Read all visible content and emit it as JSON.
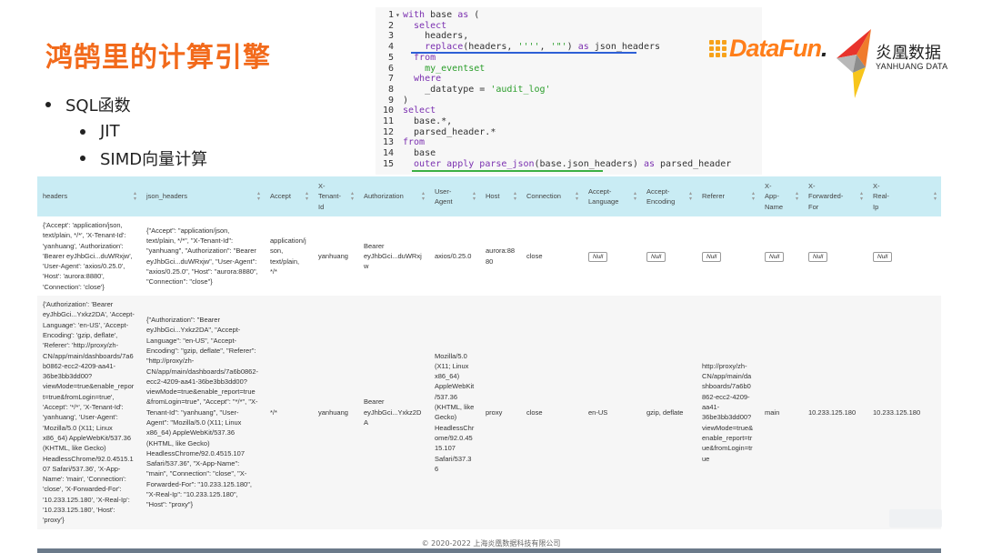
{
  "slide": {
    "title": "鸿鹄里的计算引擎",
    "bullets": [
      "SQL函数",
      "JIT",
      "SIMD向量计算"
    ]
  },
  "code_lines": [
    {
      "n": "1",
      "fold": "▾",
      "parts": [
        [
          "kw",
          "with "
        ],
        [
          "id",
          "base "
        ],
        [
          "kw",
          "as "
        ],
        [
          "id",
          "("
        ]
      ]
    },
    {
      "n": "2",
      "fold": "",
      "parts": [
        [
          "kw",
          "  select"
        ]
      ]
    },
    {
      "n": "3",
      "fold": "",
      "parts": [
        [
          "id",
          "    headers,"
        ]
      ]
    },
    {
      "n": "4",
      "fold": "",
      "parts": [
        [
          "fn",
          "    replace"
        ],
        [
          "id",
          "(headers, "
        ],
        [
          "str",
          "''''"
        ],
        [
          "id",
          ", "
        ],
        [
          "str",
          "'\"'"
        ],
        [
          "id",
          ") "
        ],
        [
          "kw",
          "as "
        ],
        [
          "id",
          "json_headers"
        ]
      ]
    },
    {
      "n": "5",
      "fold": "",
      "parts": [
        [
          "kw",
          "  from"
        ]
      ]
    },
    {
      "n": "6",
      "fold": "",
      "parts": [
        [
          "str",
          "    my_eventset"
        ]
      ]
    },
    {
      "n": "7",
      "fold": "",
      "parts": [
        [
          "kw",
          "  where"
        ]
      ]
    },
    {
      "n": "8",
      "fold": "",
      "parts": [
        [
          "id",
          "    _datatype = "
        ],
        [
          "str",
          "'audit_log'"
        ]
      ]
    },
    {
      "n": "9",
      "fold": "",
      "parts": [
        [
          "id",
          ")"
        ]
      ]
    },
    {
      "n": "10",
      "fold": "",
      "parts": [
        [
          "kw",
          "select"
        ]
      ]
    },
    {
      "n": "11",
      "fold": "",
      "parts": [
        [
          "id",
          "  base.*,"
        ]
      ]
    },
    {
      "n": "12",
      "fold": "",
      "parts": [
        [
          "id",
          "  parsed_header.*"
        ]
      ]
    },
    {
      "n": "13",
      "fold": "",
      "parts": [
        [
          "kw",
          "from"
        ]
      ]
    },
    {
      "n": "14",
      "fold": "",
      "parts": [
        [
          "id",
          "  base"
        ]
      ]
    },
    {
      "n": "15",
      "fold": "",
      "parts": [
        [
          "kw",
          "  outer apply "
        ],
        [
          "fn",
          "parse_json"
        ],
        [
          "id",
          "(base.json_headers) "
        ],
        [
          "kw",
          "as "
        ],
        [
          "id",
          "parsed_header"
        ]
      ]
    }
  ],
  "logos": {
    "datafun_prefix": "D",
    "datafun_mid": "ataFun",
    "datafun_dot": ".",
    "yanhuang_cn": "炎凰数据",
    "yanhuang_en": "YANHUANG DATA"
  },
  "table": {
    "columns": [
      "headers",
      "json_headers",
      "Accept",
      "X-\nTenant-\nId",
      "Authorization",
      "User-\nAgent",
      "Host",
      "Connection",
      "Accept-\nLanguage",
      "Accept-\nEncoding",
      "Referer",
      "X-\nApp-\nName",
      "X-\nForwarded-\nFor",
      "X-\nReal-\nIp"
    ],
    "null_label": "Null",
    "rows": [
      {
        "headers": "{'Accept': 'application/json, text/plain, */*', 'X-Tenant-Id': 'yanhuang', 'Authorization': 'Bearer eyJhbGci...duWRxjw', 'User-Agent': 'axios/0.25.0', 'Host': 'aurora:8880', 'Connection': 'close'}",
        "json_headers": "{\"Accept\": \"application/json, text/plain, */*\", \"X-Tenant-Id\": \"yanhuang\", \"Authorization\": \"Bearer eyJhbGci...duWRxjw\", \"User-Agent\": \"axios/0.25.0\", \"Host\": \"aurora:8880\", \"Connection\": \"close\"}",
        "accept": "application/json, text/plain, */*",
        "tenant": "yanhuang",
        "auth": "Bearer eyJhbGci...duWRxjw",
        "ua": "axios/0.25.0",
        "host": "aurora:8880",
        "conn": "close",
        "lang": null,
        "enc": null,
        "referer": null,
        "app": null,
        "fwd": null,
        "real": null
      },
      {
        "headers": "{'Authorization': 'Bearer eyJhbGci...Yxkz2DA', 'Accept-Language': 'en-US', 'Accept-Encoding': 'gzip, deflate', 'Referer': 'http://proxy/zh-CN/app/main/dashboards/7a6b0862-ecc2-4209-aa41-36be3bb3dd00?viewMode=true&enable_report=true&fromLogin=true', 'Accept': '*/*', 'X-Tenant-Id': 'yanhuang', 'User-Agent': 'Mozilla/5.0 (X11; Linux x86_64) AppleWebKit/537.36 (KHTML, like Gecko) HeadlessChrome/92.0.4515.107 Safari/537.36', 'X-App-Name': 'main', 'Connection': 'close', 'X-Forwarded-For': '10.233.125.180', 'X-Real-Ip': '10.233.125.180', 'Host': 'proxy'}",
        "json_headers": "{\"Authorization\": \"Bearer eyJhbGci...Yxkz2DA\", \"Accept-Language\": \"en-US\", \"Accept-Encoding\": \"gzip, deflate\", \"Referer\": \"http://proxy/zh-CN/app/main/dashboards/7a6b0862-ecc2-4209-aa41-36be3bb3dd00?viewMode=true&enable_report=true&fromLogin=true\", \"Accept\": \"*/*\", \"X-Tenant-Id\": \"yanhuang\", \"User-Agent\": \"Mozilla/5.0 (X11; Linux x86_64) AppleWebKit/537.36 (KHTML, like Gecko) HeadlessChrome/92.0.4515.107 Safari/537.36\", \"X-App-Name\": \"main\", \"Connection\": \"close\", \"X-Forwarded-For\": \"10.233.125.180\", \"X-Real-Ip\": \"10.233.125.180\", \"Host\": \"proxy\"}",
        "accept": "*/*",
        "tenant": "yanhuang",
        "auth": "Bearer eyJhbGci...Yxkz2DA",
        "ua": "Mozilla/5.0 (X11; Linux x86_64) AppleWebKit/537.36 (KHTML, like Gecko) HeadlessChrome/92.0.4515.107 Safari/537.36",
        "host": "proxy",
        "conn": "close",
        "lang": "en-US",
        "enc": "gzip, deflate",
        "referer": "http://proxy/zh-CN/app/main/dashboards/7a6b0862-ecc2-4209-aa41-36be3bb3dd00?viewMode=true&enable_report=true&fromLogin=true",
        "app": "main",
        "fwd": "10.233.125.180",
        "real": "10.233.125.180"
      }
    ]
  },
  "footer": "© 2020-2022 上海炎凰数据科技有限公司",
  "colors": {
    "title": "#f26a1b",
    "table_header": "#c9ecf4",
    "keyword": "#7b30b0",
    "string": "#2b9e2b"
  }
}
